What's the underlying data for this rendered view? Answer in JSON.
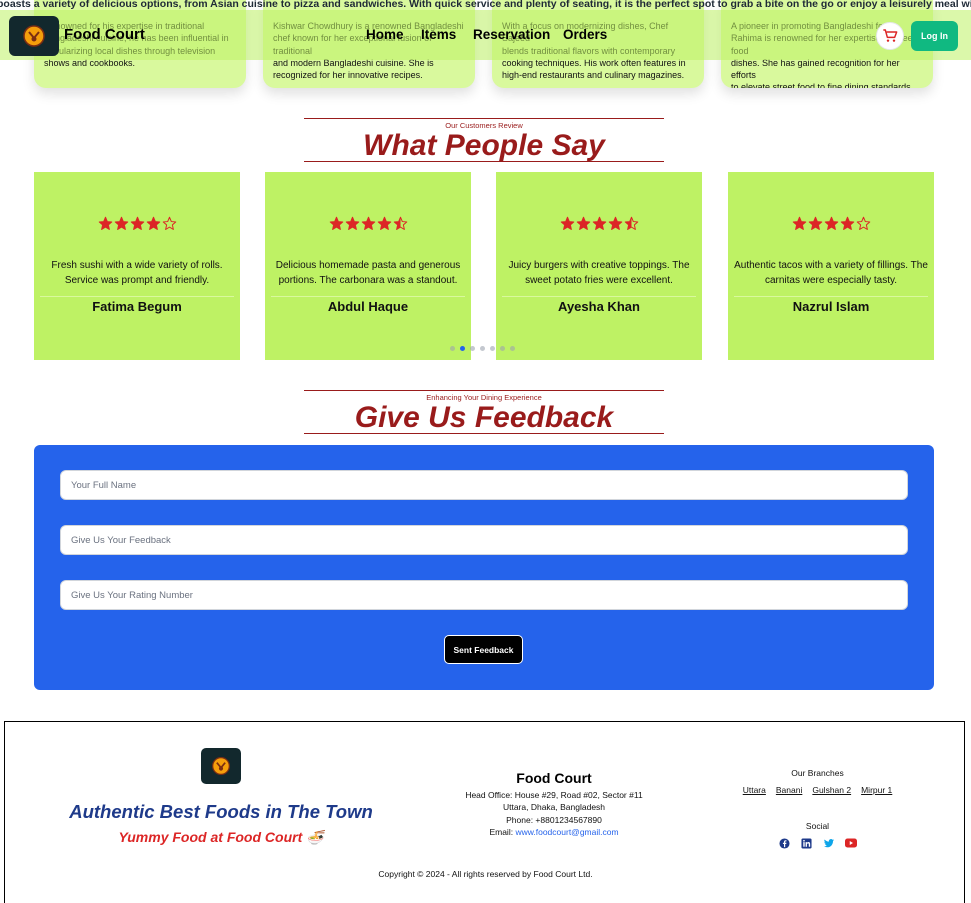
{
  "marquee": {
    "text": "boasts a variety of delicious options, from Asian cuisine to pizza and sandwiches. With quick service and plenty of seating, it is the perfect spot to grab a bite on the go or enjoy a leisurely meal with friends and family."
  },
  "chefs": [
    {
      "text": "Renowned for his expertise in traditional Bangladeshi cuisine, he has been influential in\npopularizing local dishes through television\nshows and cookbooks."
    },
    {
      "text": "Kishwar Chowdhury is a renowned Bangladeshi\nchef known for her exceptional fusion of traditional\nand modern Bangladeshi cuisine. She is\nrecognized for her innovative recipes."
    },
    {
      "text": "With a focus on modernizing dishes, Chef Sajeed\nblends traditional flavors with contemporary\ncooking techniques. His work often features in\nhigh-end restaurants and culinary magazines."
    },
    {
      "text": "A pioneer in promoting Bangladeshi food, Rahima is renowned for her expertise in street food\ndishes. She has gained recognition for her efforts\nto elevate street food to fine dining standards."
    }
  ],
  "nav": {
    "brand": "Food Court",
    "links": [
      "Home",
      "Items",
      "Reservation",
      "Orders"
    ],
    "login": "Log In",
    "cart_icon": "cart-icon"
  },
  "reviews_section": {
    "subtitle": "Our Customers Review",
    "title": "What People Say"
  },
  "reviews": [
    {
      "rating": 4,
      "text": "Fresh sushi with a wide variety of rolls. Service was prompt and friendly.",
      "name": "Fatima Begum"
    },
    {
      "rating": 4.5,
      "text": "Delicious homemade pasta and generous portions. The carbonara was a standout.",
      "name": "Abdul Haque"
    },
    {
      "rating": 4.5,
      "text": "Juicy burgers with creative toppings. The sweet potato fries were excellent.",
      "name": "Ayesha Khan"
    },
    {
      "rating": 4,
      "text": "Authentic tacos with a variety of fillings. The carnitas were especially tasty.",
      "name": "Nazrul Islam"
    }
  ],
  "carousel": {
    "dot_count": 7,
    "active_index": 1
  },
  "feedback_section": {
    "subtitle": "Enhancing Your Dining Experience",
    "title": "Give Us Feedback"
  },
  "feedback_form": {
    "name_placeholder": "Your Full Name",
    "feedback_placeholder": "Give Us Your Feedback",
    "rating_placeholder": "Give Us Your Rating Number",
    "submit_label": "Sent Feedback"
  },
  "footer": {
    "tagline": "Authentic Best Foods in The Town",
    "subtagline": "Yummy Food at Food Court 🍜",
    "name": "Food Court",
    "address_line1": "Head Office: House #29, Road #02, Sector #11",
    "address_line2": "Uttara, Dhaka, Bangladesh",
    "phone": "Phone: +8801234567890",
    "email_label": "Email: ",
    "email": "www.foodcourt@gmail.com",
    "branches_label": "Our Branches",
    "branches": [
      "Uttara",
      "Banani",
      "Gulshan 2",
      "Mirpur 1"
    ],
    "social_label": "Social",
    "social": [
      "facebook-icon",
      "linkedin-icon",
      "twitter-icon",
      "youtube-icon"
    ],
    "copyright": "Copyright © 2024 - All rights reserved by Food Court Ltd."
  },
  "colors": {
    "nav_bg": "#bef264",
    "card_bg": "#bef264",
    "heading_red": "#991b1b",
    "form_blue": "#2563eb",
    "login_green": "#10b981",
    "star_red": "#dc2626"
  }
}
